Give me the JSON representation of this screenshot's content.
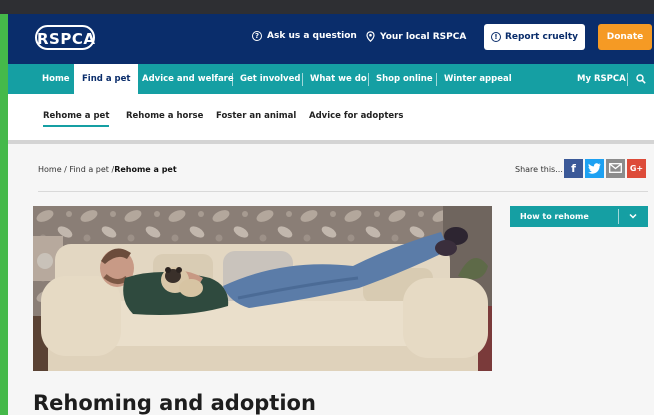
{
  "header": {
    "logo_text": "RSPCA",
    "ask_label": "Ask us a question",
    "local_label": "Your local RSPCA",
    "report_label": "Report cruelty",
    "donate_label": "Donate"
  },
  "nav": {
    "items": [
      "Home",
      "Find a pet",
      "Advice and welfare",
      "Get involved",
      "What we do",
      "Shop online",
      "Winter appeal"
    ],
    "active": "Find a pet",
    "my_rspca": "My RSPCA"
  },
  "subnav": {
    "items": [
      "Rehome a pet",
      "Rehome a horse",
      "Foster an animal",
      "Advice for adopters"
    ],
    "active": "Rehome a pet"
  },
  "breadcrumb": {
    "home": "Home",
    "find": "Find a pet",
    "current": "Rehome a pet"
  },
  "share": {
    "label": "Share this...",
    "facebook": "f",
    "google": "G+"
  },
  "sidebar": {
    "how_to_rehome": "How to rehome"
  },
  "page": {
    "title": "Rehoming and adoption"
  },
  "colors": {
    "header_blue": "#0a2d6b",
    "teal": "#159fa3",
    "donate_orange": "#f59a24",
    "accent_green": "#45b94a"
  }
}
